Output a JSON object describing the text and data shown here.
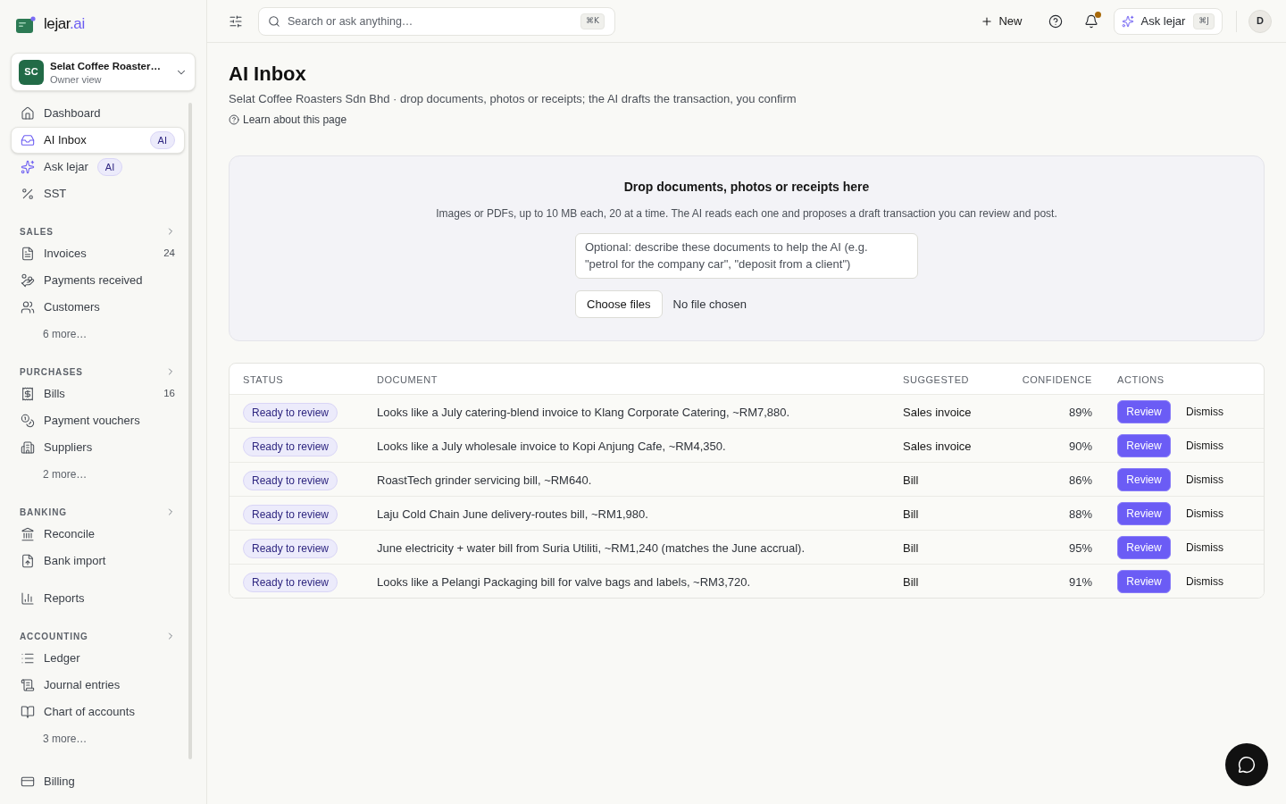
{
  "sidebar": {
    "logo": {
      "name": "lejar",
      "suffix": ".ai"
    },
    "workspace": {
      "initials": "SC",
      "name": "Selat Coffee Roaster…",
      "role": "Owner view"
    },
    "nav": [
      {
        "items": [
          {
            "label": "Dashboard",
            "selected": false
          },
          {
            "label": "AI Inbox",
            "selected": true,
            "badge": "AI"
          },
          {
            "label": "Ask lejar",
            "selected": false,
            "badge": "AI"
          },
          {
            "label": "SST",
            "selected": false
          }
        ]
      },
      {
        "heading": "SALES",
        "items": [
          {
            "label": "Invoices",
            "selected": false,
            "count": "24"
          },
          {
            "label": "Payments received",
            "selected": false
          },
          {
            "label": "Customers",
            "selected": false
          }
        ],
        "more": "6 more…"
      },
      {
        "heading": "PURCHASES",
        "items": [
          {
            "label": "Bills",
            "selected": false,
            "count": "16"
          },
          {
            "label": "Payment vouchers",
            "selected": false
          },
          {
            "label": "Suppliers",
            "selected": false
          }
        ],
        "more": "2 more…"
      },
      {
        "heading": "BANKING",
        "items": [
          {
            "label": "Reconcile",
            "selected": false
          },
          {
            "label": "Bank import",
            "selected": false
          }
        ]
      },
      {
        "items": [
          {
            "label": "Reports",
            "selected": false
          }
        ]
      },
      {
        "heading": "ACCOUNTING",
        "items": [
          {
            "label": "Ledger",
            "selected": false
          },
          {
            "label": "Journal entries",
            "selected": false
          },
          {
            "label": "Chart of accounts",
            "selected": false
          }
        ],
        "more": "3 more…"
      }
    ],
    "footer_item": {
      "label": "Billing",
      "selected": false
    }
  },
  "topbar": {
    "search": {
      "placeholder": "Search or ask anything…",
      "shortcut": "⌘K"
    },
    "new_button": "New",
    "notifications": {
      "unread": true
    },
    "ask_button": {
      "label": "Ask lejar",
      "shortcut": "⌘J"
    },
    "avatar": "D"
  },
  "page": {
    "title": "AI Inbox",
    "subtitle": "Selat Coffee Roasters Sdn Bhd · drop documents, photos or receipts; the AI drafts the transaction, you confirm",
    "help_link": "Learn about this page"
  },
  "drop_zone": {
    "title": "Drop documents, photos or receipts here",
    "description": "Images or PDFs, up to 10 MB each, 20 at a time. The AI reads each one and proposes a draft transaction you can review and post.",
    "note": {
      "placeholder": "Optional: describe these documents to help the AI (e.g. \"petrol for the company car\", \"deposit from a client\")"
    },
    "file_button": "Choose files",
    "file_status": "No file chosen"
  },
  "inbox_table": {
    "columns": [
      "STATUS",
      "DOCUMENT",
      "SUGGESTED",
      "CONFIDENCE",
      "ACTIONS"
    ],
    "rows": [
      {
        "status": "Ready to review",
        "document": "Looks like a July catering-blend invoice to Klang Corporate Catering, ~RM7,880.",
        "suggested": "Sales invoice",
        "confidence": "89%",
        "actions": [
          {
            "kind": "primary",
            "label": "Review"
          },
          {
            "kind": "plain",
            "label": "Dismiss"
          }
        ]
      },
      {
        "status": "Ready to review",
        "document": "Looks like a July wholesale invoice to Kopi Anjung Cafe, ~RM4,350.",
        "suggested": "Sales invoice",
        "confidence": "90%",
        "actions": [
          {
            "kind": "primary",
            "label": "Review"
          },
          {
            "kind": "plain",
            "label": "Dismiss"
          }
        ]
      },
      {
        "status": "Ready to review",
        "document": "RoastTech grinder servicing bill, ~RM640.",
        "suggested": "Bill",
        "confidence": "86%",
        "actions": [
          {
            "kind": "primary",
            "label": "Review"
          },
          {
            "kind": "plain",
            "label": "Dismiss"
          }
        ]
      },
      {
        "status": "Ready to review",
        "document": "Laju Cold Chain June delivery-routes bill, ~RM1,980.",
        "suggested": "Bill",
        "confidence": "88%",
        "actions": [
          {
            "kind": "primary",
            "label": "Review"
          },
          {
            "kind": "plain",
            "label": "Dismiss"
          }
        ]
      },
      {
        "status": "Ready to review",
        "document": "June electricity + water bill from Suria Utiliti, ~RM1,240 (matches the June accrual).",
        "suggested": "Bill",
        "confidence": "95%",
        "actions": [
          {
            "kind": "primary",
            "label": "Review"
          },
          {
            "kind": "plain",
            "label": "Dismiss"
          }
        ]
      },
      {
        "status": "Ready to review",
        "document": "Looks like a Pelangi Packaging bill for valve bags and labels, ~RM3,720.",
        "suggested": "Bill",
        "confidence": "91%",
        "actions": [
          {
            "kind": "primary",
            "label": "Review"
          },
          {
            "kind": "plain",
            "label": "Dismiss"
          }
        ]
      }
    ]
  }
}
